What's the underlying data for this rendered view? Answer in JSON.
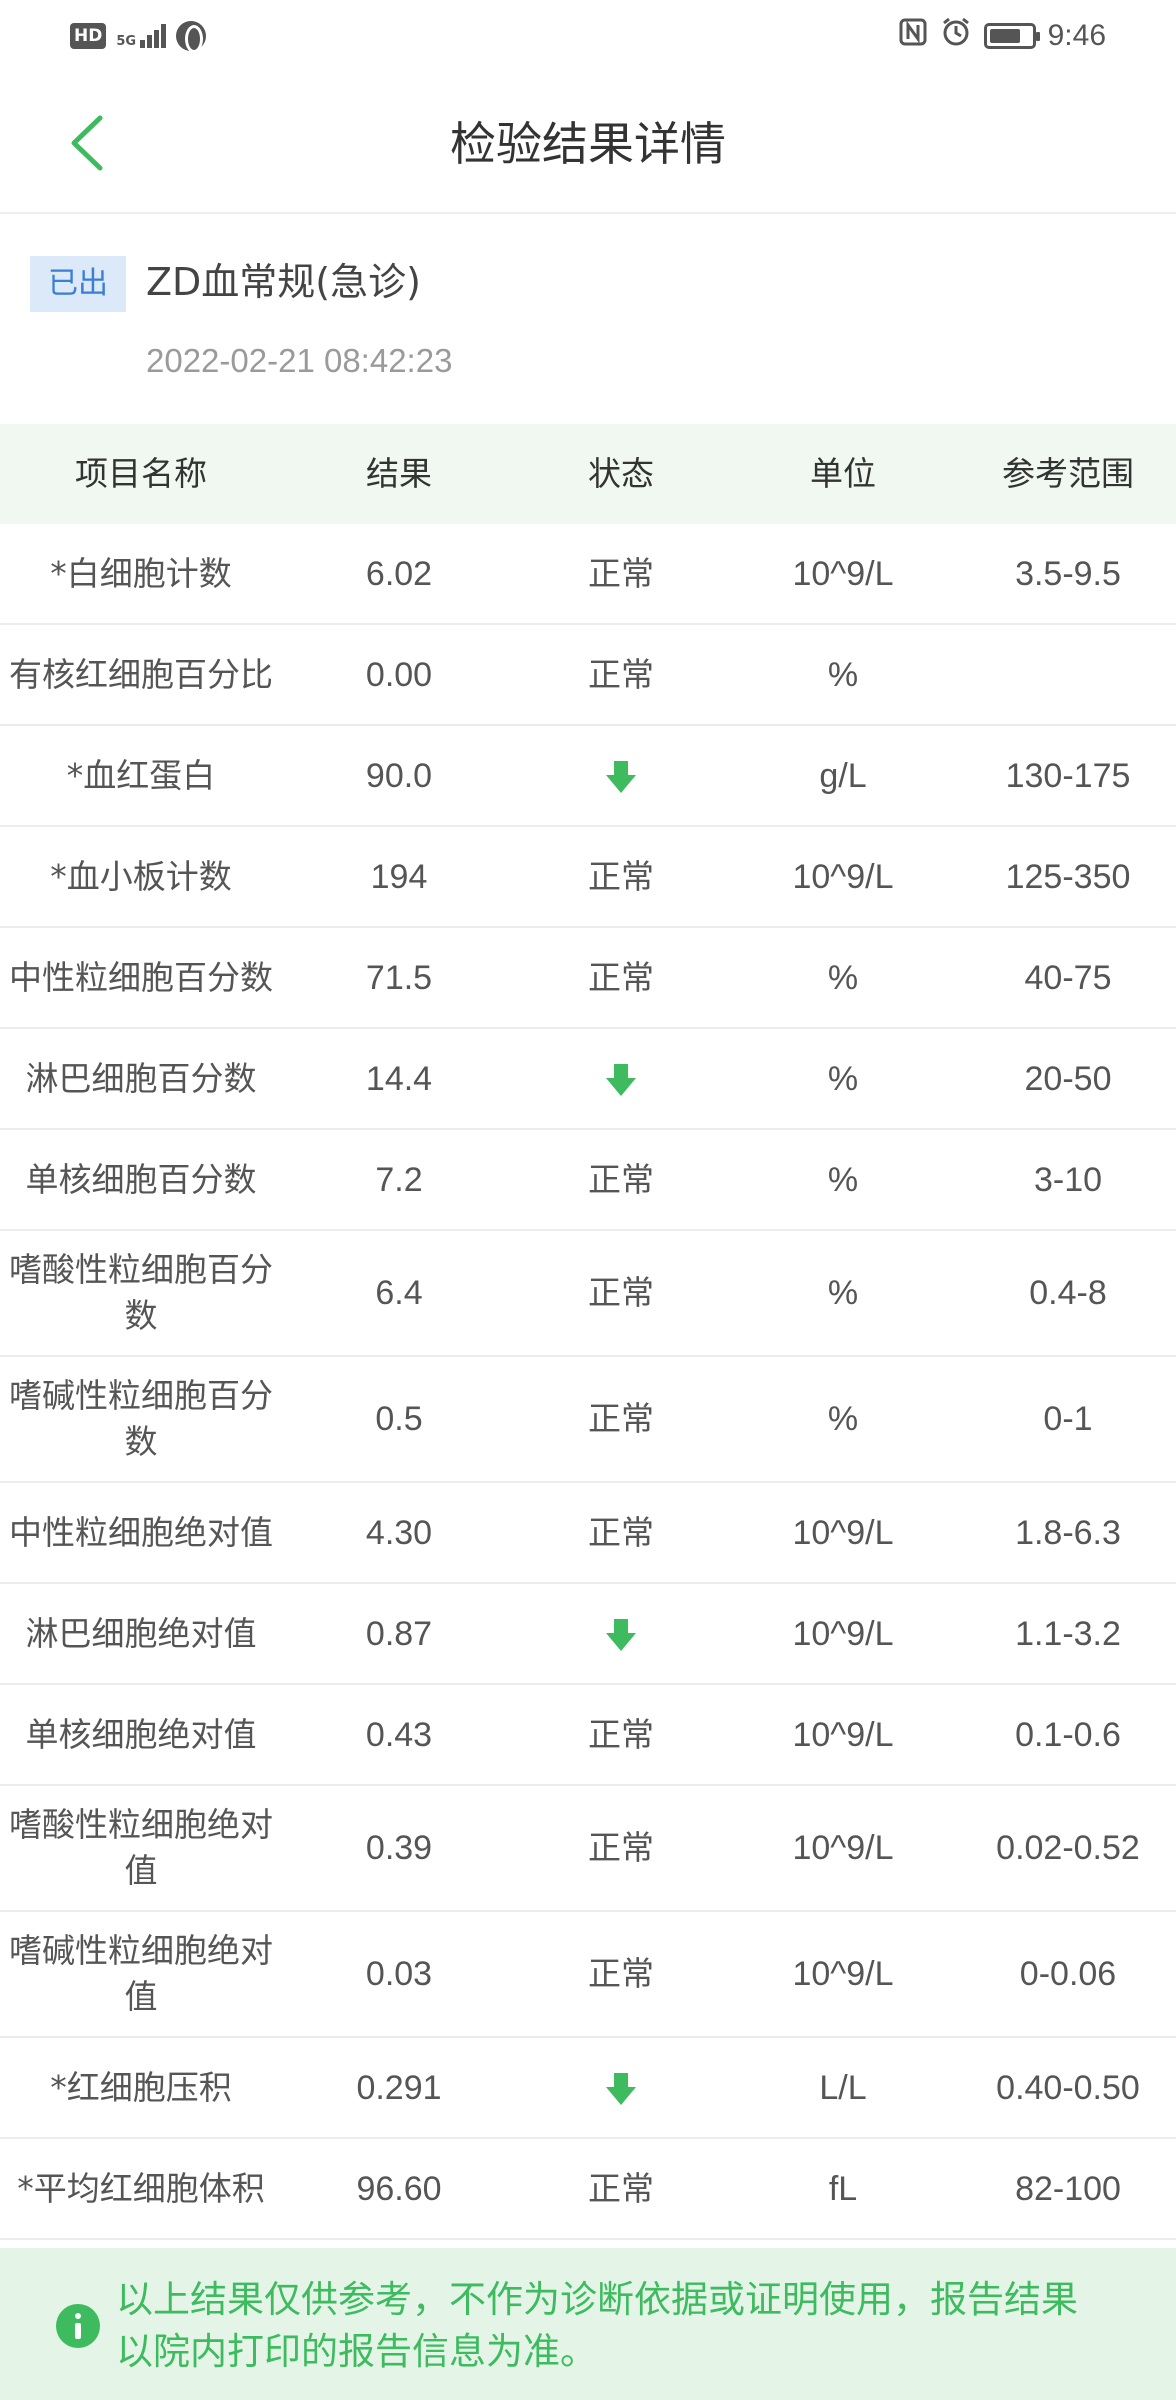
{
  "status_bar": {
    "hd": "HD",
    "network": "5G",
    "time": "9:46",
    "battery_level": 0.75,
    "icons": [
      "hd-icon",
      "signal-icon",
      "globe-icon",
      "nfc-icon",
      "alarm-icon",
      "battery-icon"
    ]
  },
  "nav": {
    "title": "检验结果详情",
    "back_icon": "chevron-left-icon"
  },
  "report": {
    "status_badge": "已出",
    "name": "ZD血常规(急诊)",
    "datetime": "2022-02-21 08:42:23"
  },
  "table": {
    "headers": [
      "项目名称",
      "结果",
      "状态",
      "单位",
      "参考范围"
    ],
    "rows": [
      {
        "name": "*白细胞计数",
        "result": "6.02",
        "status": "正常",
        "unit": "10^9/L",
        "range": "3.5-9.5"
      },
      {
        "name": "有核红细胞百分比",
        "result": "0.00",
        "status": "正常",
        "unit": "%",
        "range": ""
      },
      {
        "name": "*血红蛋白",
        "result": "90.0",
        "status": "low",
        "unit": "g/L",
        "range": "130-175"
      },
      {
        "name": "*血小板计数",
        "result": "194",
        "status": "正常",
        "unit": "10^9/L",
        "range": "125-350"
      },
      {
        "name": "中性粒细胞百分数",
        "result": "71.5",
        "status": "正常",
        "unit": "%",
        "range": "40-75"
      },
      {
        "name": "淋巴细胞百分数",
        "result": "14.4",
        "status": "low",
        "unit": "%",
        "range": "20-50"
      },
      {
        "name": "单核细胞百分数",
        "result": "7.2",
        "status": "正常",
        "unit": "%",
        "range": "3-10"
      },
      {
        "name": "嗜酸性粒细胞百分数",
        "result": "6.4",
        "status": "正常",
        "unit": "%",
        "range": "0.4-8"
      },
      {
        "name": "嗜碱性粒细胞百分数",
        "result": "0.5",
        "status": "正常",
        "unit": "%",
        "range": "0-1"
      },
      {
        "name": "中性粒细胞绝对值",
        "result": "4.30",
        "status": "正常",
        "unit": "10^9/L",
        "range": "1.8-6.3"
      },
      {
        "name": "淋巴细胞绝对值",
        "result": "0.87",
        "status": "low",
        "unit": "10^9/L",
        "range": "1.1-3.2"
      },
      {
        "name": "单核细胞绝对值",
        "result": "0.43",
        "status": "正常",
        "unit": "10^9/L",
        "range": "0.1-0.6"
      },
      {
        "name": "嗜酸性粒细胞绝对值",
        "result": "0.39",
        "status": "正常",
        "unit": "10^9/L",
        "range": "0.02-0.52"
      },
      {
        "name": "嗜碱性粒细胞绝对值",
        "result": "0.03",
        "status": "正常",
        "unit": "10^9/L",
        "range": "0-0.06"
      },
      {
        "name": "*红细胞压积",
        "result": "0.291",
        "status": "low",
        "unit": "L/L",
        "range": "0.40-0.50"
      },
      {
        "name": "*平均红细胞体积",
        "result": "96.60",
        "status": "正常",
        "unit": "fL",
        "range": "82-100"
      }
    ]
  },
  "notice": {
    "text": "以上结果仅供参考，不作为诊断依据或证明使用，报告结果以院内打印的报告信息为准。",
    "icon": "info-icon"
  },
  "colors": {
    "accent_green": "#3dbb5e",
    "badge_bg": "#dbe9f8",
    "badge_text": "#3a7fd5",
    "header_bg": "#f1f8f1",
    "notice_bg": "#e4f5e8"
  }
}
